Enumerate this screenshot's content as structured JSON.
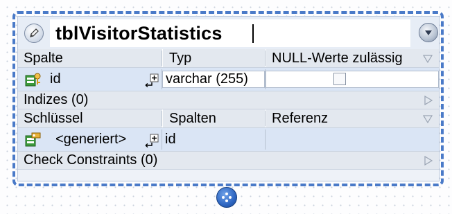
{
  "table": {
    "name": "tblVisitorStatistics",
    "edit_icon": "pencil-icon",
    "collapse_icon": "chevron-down-icon"
  },
  "columns_section": {
    "headers": [
      "Spalte",
      "Typ",
      "NULL-Werte zulässig"
    ],
    "rows": [
      {
        "name": "id",
        "type": "varchar (255)",
        "nullable": false,
        "icon": "primary-key-column-icon"
      }
    ]
  },
  "indexes_section": {
    "label": "Indizes (0)"
  },
  "keys_section": {
    "headers": [
      "Schlüssel",
      "Spalten",
      "Referenz"
    ],
    "rows": [
      {
        "name": "<generiert>",
        "columns": "id",
        "reference": "",
        "icon": "key-icon"
      }
    ]
  },
  "checks_section": {
    "label": "Check Constraints (0)"
  },
  "colors": {
    "frame": "#4a7ac8",
    "header": "#e3e8ef",
    "row": "#dae5f5"
  }
}
